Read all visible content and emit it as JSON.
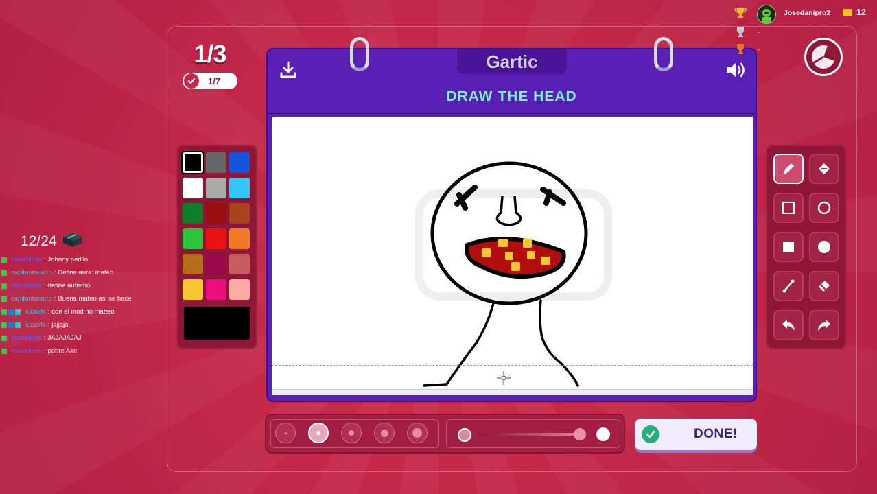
{
  "round": {
    "current": "1/3",
    "guessed": "1/7"
  },
  "prompt": "DRAW THE HEAD",
  "logo_text": "Gartic",
  "done_label": "DONE!",
  "user": {
    "name": "Josedanipro2",
    "coins": "12"
  },
  "scores": {
    "second": "-",
    "third": "-"
  },
  "chat": {
    "counter": "12/24",
    "messages": [
      {
        "user": "maxiloluso",
        "text": "Johnny pedilo"
      },
      {
        "user": "capitanbalatro",
        "text": "Define aura: mateo"
      },
      {
        "user": "maxiloluso",
        "text": "define autismo"
      },
      {
        "user": "capitanbalatro",
        "text": "Buena mateo asi se hace"
      },
      {
        "user": "lucasfx",
        "text": "con el mod no matteo"
      },
      {
        "user": "lucasfx",
        "text": "jajjaja"
      },
      {
        "user": "maxiloluso",
        "text": "JAJAJAJAJ"
      },
      {
        "user": "maxiloluso",
        "text": "pobre Axel"
      }
    ]
  },
  "palette": {
    "colors": [
      "#000000",
      "#666666",
      "#1754d8",
      "#ffffff",
      "#aaaaaa",
      "#35c5f5",
      "#0d7e25",
      "#9c0d0d",
      "#a8431c",
      "#2bc43b",
      "#ea1212",
      "#f27a25",
      "#b46c1d",
      "#9a0a4a",
      "#c95c5c",
      "#f9c633",
      "#ea0f7c",
      "#fbaaa5"
    ],
    "selected": "#000000"
  },
  "tools": [
    "pencil-icon",
    "fill-bucket-icon",
    "rectangle-outline-icon",
    "ellipse-outline-icon",
    "rectangle-filled-icon",
    "ellipse-filled-icon",
    "line-icon",
    "eraser-icon",
    "undo-icon",
    "redo-icon"
  ],
  "brush": {
    "selected_size": 2,
    "opacity_selected": 1.0
  },
  "drawing_colors": {
    "outline": "#000000",
    "mouth": "#b30e0e",
    "teeth": "#f9c633"
  }
}
